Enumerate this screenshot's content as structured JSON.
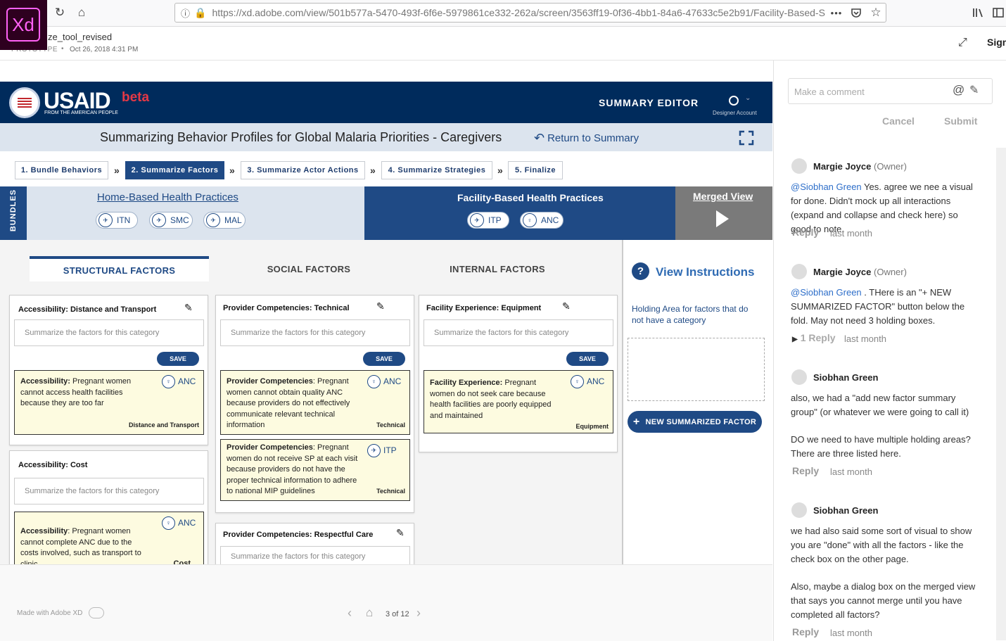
{
  "browser": {
    "url": "https://xd.adobe.com/view/501b577a-5470-493f-6f6e-5979861ce332-262a/screen/3563ff19-0f36-4bb1-84a6-47633c5e2b91/Facility-Based-S",
    "more_label": "•••"
  },
  "xd": {
    "logo": "Xd",
    "doc_title": "ze_tool_revised",
    "doc_type": "PROTOTYPE",
    "doc_date": "Oct 26, 2018 4:31 PM",
    "sign_label": "Sign",
    "made_with": "Made with Adobe XD",
    "page_indicator": "3 of 12"
  },
  "app": {
    "brand": "USAID",
    "brand_sub": "FROM THE AMERICAN PEOPLE",
    "beta": "beta",
    "mode": "SUMMARY EDITOR",
    "account": "Designer Account",
    "page_title": "Summarizing Behavior Profiles for Global Malaria Priorities - Caregivers",
    "return_label": "Return to Summary",
    "steps": [
      "1. Bundle Behaviors",
      "2. Summarize Factors",
      "3. Summarize Actor Actions",
      "4. Summarize Strategies",
      "5. Finalize"
    ],
    "bundles_label": "BUNDLES",
    "bundle_home": {
      "title": "Home-Based Health Practices",
      "pills": [
        "ITN",
        "SMC",
        "MAL"
      ]
    },
    "bundle_facility": {
      "title": "Facility-Based Health Practices",
      "pills": [
        "ITP",
        "ANC"
      ]
    },
    "merged_view": "Merged View",
    "tabs": [
      "STRUCTURAL FACTORS",
      "SOCIAL FACTORS",
      "INTERNAL FACTORS"
    ],
    "placeholder": "Summarize the factors for this category",
    "save": "SAVE",
    "col1": {
      "card1": {
        "title": "Accessibility: Distance and Transport",
        "factor": {
          "bold": "Accessibility:",
          "text": " Pregnant women cannot access health facilities because they are too far",
          "badge": "ANC",
          "tag": "Distance and Transport"
        }
      },
      "card2": {
        "title": "Accessibility: Cost",
        "factor": {
          "bold": "Accessibility",
          "text": ": Pregnant women cannot complete ANC due to the costs involved, such as transport to clinic",
          "badge": "ANC",
          "tag": "Cost"
        }
      }
    },
    "col2": {
      "card1": {
        "title": "Provider Competencies: Technical",
        "factor1": {
          "bold": "Provider Competencies",
          "text": ": Pregnant women cannot obtain quality ANC because providers do not effectively communicate relevant technical information",
          "badge": "ANC",
          "tag": "Technical"
        },
        "factor2": {
          "bold": "Provider Competencies",
          "text": ": Pregnant women do not receive SP at each visit because providers do not have the proper technical information to adhere to national MIP guidelines",
          "badge": "ITP",
          "tag": "Technical"
        }
      },
      "card2": {
        "title": "Provider Competencies: Respectful Care"
      }
    },
    "col3": {
      "card1": {
        "title": "Facility Experience: Equipment",
        "factor": {
          "bold": "Facility Experience:",
          "text": " Pregnant women do not seek care because health facilities are poorly equipped and maintained",
          "badge": "ANC",
          "tag": "Equipment"
        }
      }
    },
    "sidebar": {
      "help_icon": "?",
      "instructions": "View Instructions",
      "holding_text": "Holding Area for factors that do not have a category",
      "new_factor": "NEW SUMMARIZED FACTOR"
    }
  },
  "comments": {
    "placeholder": "Make a comment",
    "cancel": "Cancel",
    "submit": "Submit",
    "items": [
      {
        "author": "Margie Joyce",
        "role": "(Owner)",
        "mention": "@Siobhan Green",
        "body": " Yes. agree we nee a visual for done. Didn't mock up all interactions (expand and collapse and check here) so good to note.",
        "reply": "Reply",
        "time": "last month"
      },
      {
        "author": "Margie Joyce",
        "role": "(Owner)",
        "mention": "@Siobhan Green",
        "body": " . THere is an \"+ NEW SUMMARIZED FACTOR\" button below the fold. May not need 3 holding boxes.",
        "reply": "1 Reply",
        "time": "last month"
      },
      {
        "author": "Siobhan Green",
        "body1": "also, we had a \"add new factor summary group\" (or whatever we were going to call it)",
        "body2": "DO we need to have multiple holding areas? There are three listed here.",
        "reply": "Reply",
        "time": "last month"
      },
      {
        "author": "Siobhan Green",
        "body1": "we had also said some sort of visual to show you are \"done\" with all the factors  - like the check box on the other page.",
        "body2": "Also, maybe a dialog box on the merged view that says you cannot merge until you have completed all factors?",
        "reply": "Reply",
        "time": "last month"
      }
    ]
  }
}
